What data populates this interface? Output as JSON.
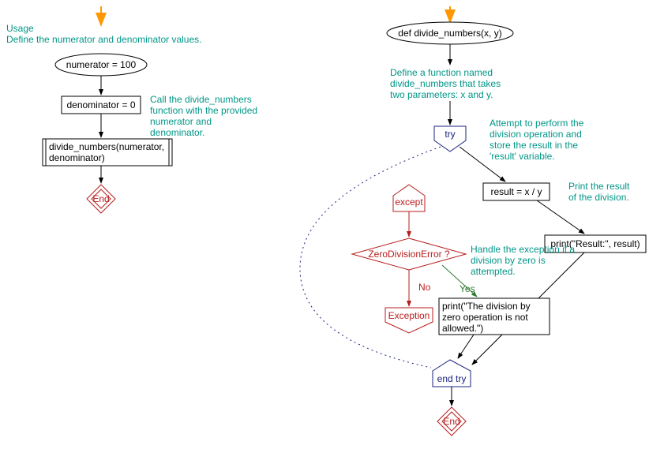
{
  "left": {
    "usage_line1": "Usage",
    "usage_line2": "Define the numerator and denominator values.",
    "numerator": "numerator = 100",
    "denominator": "denominator = 0",
    "call_line1": "divide_numbers(numerator,",
    "call_line2": "denominator)",
    "call_note_line1": "Call the divide_numbers",
    "call_note_line2": "function with the provided",
    "call_note_line3": "numerator and",
    "call_note_line4": "denominator.",
    "end": "End"
  },
  "right": {
    "func_def": "def divide_numbers(x, y)",
    "func_note_line1": "Define a function named",
    "func_note_line2": "divide_numbers that takes",
    "func_note_line3": "two parameters: x and y.",
    "try": "try",
    "try_note_line1": "Attempt to perform the",
    "try_note_line2": "division operation and",
    "try_note_line3": "store the result in the",
    "try_note_line4": "'result' variable.",
    "result": "result = x / y",
    "print_note_line1": "Print the result",
    "print_note_line2": "of the division.",
    "print_result": "print(\"Result:\", result)",
    "except": "except",
    "zde": "ZeroDivisionError ?",
    "zde_note_line1": "Handle the exception if a",
    "zde_note_line2": "division by zero is",
    "zde_note_line3": "attempted.",
    "no": "No",
    "yes": "Yes",
    "exception": "Exception",
    "handler_line1": "print(\"The division by",
    "handler_line2": "zero operation is not",
    "handler_line3": "allowed.\")",
    "end_try": "end try",
    "end": "End"
  },
  "colors": {
    "teal": "#009688",
    "blue": "#1a237e",
    "red": "#b71c1c",
    "green": "#2e7d32",
    "orange": "#ff9800",
    "black": "#000000"
  }
}
